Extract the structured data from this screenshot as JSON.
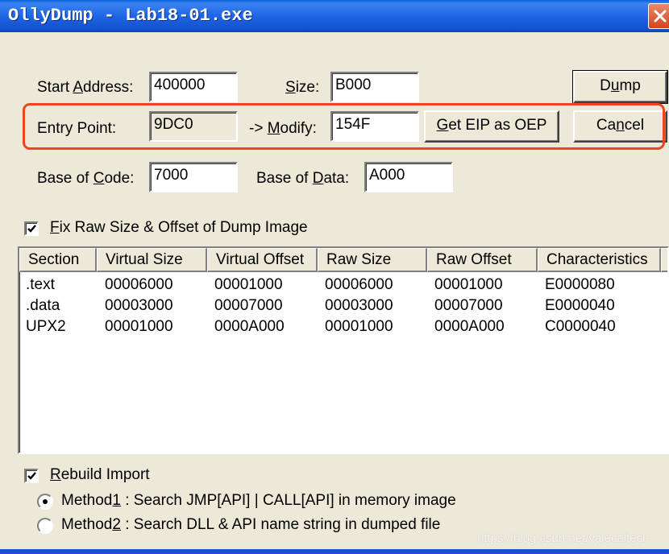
{
  "window": {
    "title": "OllyDump - Lab18-01.exe"
  },
  "fields": {
    "start_address": {
      "label_pre": "Start ",
      "label_accel": "A",
      "label_post": "ddress:",
      "value": "400000"
    },
    "size": {
      "label_pre": "",
      "label_accel": "S",
      "label_post": "ize:",
      "value": "B000"
    },
    "entry_point": {
      "label": "Entry Point:",
      "value": "9DC0"
    },
    "modify": {
      "label_pre": "-> ",
      "label_accel": "M",
      "label_post": "odify:",
      "value": "154F"
    },
    "base_of_code": {
      "label_pre": "Base of ",
      "label_accel": "C",
      "label_post": "ode:",
      "value": "7000"
    },
    "base_of_data": {
      "label_pre": "Base of ",
      "label_accel": "D",
      "label_post": "ata:",
      "value": "A000"
    }
  },
  "buttons": {
    "dump": {
      "pre": "D",
      "accel": "u",
      "post": "mp"
    },
    "get_eip": {
      "pre": "",
      "accel": "G",
      "post": "et EIP as OEP"
    },
    "cancel": {
      "pre": "Ca",
      "accel": "n",
      "post": "cel"
    }
  },
  "fix_raw": {
    "checked": true,
    "label_pre": "",
    "label_accel": "F",
    "label_post": "ix Raw Size & Offset of Dump Image"
  },
  "sections_table": {
    "columns": [
      "Section",
      "Virtual Size",
      "Virtual Offset",
      "Raw Size",
      "Raw Offset",
      "Characteristics"
    ],
    "rows": [
      [
        ".text",
        "00006000",
        "00001000",
        "00006000",
        "00001000",
        "E0000080"
      ],
      [
        ".data",
        "00003000",
        "00007000",
        "00003000",
        "00007000",
        "E0000040"
      ],
      [
        "UPX2",
        "00001000",
        "0000A000",
        "00001000",
        "0000A000",
        "C0000040"
      ]
    ]
  },
  "rebuild_import": {
    "checked": true,
    "label_pre": "",
    "label_accel": "R",
    "label_post": "ebuild Import"
  },
  "methods": [
    {
      "pre": "Method",
      "accel": "1",
      "post": " : Search JMP[API] | CALL[API] in memory image",
      "selected": true
    },
    {
      "pre": "Method",
      "accel": "2",
      "post": " : Search DLL & API name string in dumped file",
      "selected": false
    }
  ],
  "watermark": "https://blog.csdn.net/yalecaltech",
  "colors": {
    "highlight": "#f0441c",
    "titlebar": "#1e66e6",
    "dialog_bg": "#ece9d8"
  }
}
